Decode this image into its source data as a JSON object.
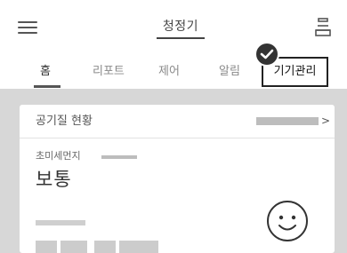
{
  "header": {
    "title": "청정기",
    "menu_icon": "hamburger-menu-icon",
    "device_icon": "device-list-icon"
  },
  "tabs": {
    "items": [
      {
        "label": "홈"
      },
      {
        "label": "리포트"
      },
      {
        "label": "제어"
      },
      {
        "label": "알림"
      },
      {
        "label": "기기관리"
      }
    ],
    "active": "홈",
    "highlighted": "기기관리"
  },
  "card": {
    "title": "공기질 현황",
    "arrow": ">",
    "pm_label": "초미세먼지",
    "pm_status": "보통",
    "status_icon": "smiley-face-icon"
  },
  "colors": {
    "content_background": "#d7d7d7",
    "card_background": "#ffffff",
    "placeholder_bar": "#bdbdbd",
    "badge": "#333333"
  }
}
